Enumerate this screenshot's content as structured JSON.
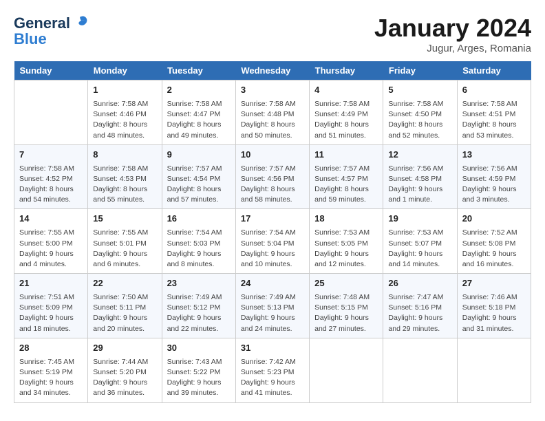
{
  "logo": {
    "line1": "General",
    "line2": "Blue"
  },
  "title": "January 2024",
  "location": "Jugur, Arges, Romania",
  "days_header": [
    "Sunday",
    "Monday",
    "Tuesday",
    "Wednesday",
    "Thursday",
    "Friday",
    "Saturday"
  ],
  "weeks": [
    [
      {
        "day": "",
        "sunrise": "",
        "sunset": "",
        "daylight": ""
      },
      {
        "day": "1",
        "sunrise": "7:58 AM",
        "sunset": "4:46 PM",
        "daylight": "8 hours and 48 minutes."
      },
      {
        "day": "2",
        "sunrise": "7:58 AM",
        "sunset": "4:47 PM",
        "daylight": "8 hours and 49 minutes."
      },
      {
        "day": "3",
        "sunrise": "7:58 AM",
        "sunset": "4:48 PM",
        "daylight": "8 hours and 50 minutes."
      },
      {
        "day": "4",
        "sunrise": "7:58 AM",
        "sunset": "4:49 PM",
        "daylight": "8 hours and 51 minutes."
      },
      {
        "day": "5",
        "sunrise": "7:58 AM",
        "sunset": "4:50 PM",
        "daylight": "8 hours and 52 minutes."
      },
      {
        "day": "6",
        "sunrise": "7:58 AM",
        "sunset": "4:51 PM",
        "daylight": "8 hours and 53 minutes."
      }
    ],
    [
      {
        "day": "7",
        "sunrise": "7:58 AM",
        "sunset": "4:52 PM",
        "daylight": "8 hours and 54 minutes."
      },
      {
        "day": "8",
        "sunrise": "7:58 AM",
        "sunset": "4:53 PM",
        "daylight": "8 hours and 55 minutes."
      },
      {
        "day": "9",
        "sunrise": "7:57 AM",
        "sunset": "4:54 PM",
        "daylight": "8 hours and 57 minutes."
      },
      {
        "day": "10",
        "sunrise": "7:57 AM",
        "sunset": "4:56 PM",
        "daylight": "8 hours and 58 minutes."
      },
      {
        "day": "11",
        "sunrise": "7:57 AM",
        "sunset": "4:57 PM",
        "daylight": "8 hours and 59 minutes."
      },
      {
        "day": "12",
        "sunrise": "7:56 AM",
        "sunset": "4:58 PM",
        "daylight": "9 hours and 1 minute."
      },
      {
        "day": "13",
        "sunrise": "7:56 AM",
        "sunset": "4:59 PM",
        "daylight": "9 hours and 3 minutes."
      }
    ],
    [
      {
        "day": "14",
        "sunrise": "7:55 AM",
        "sunset": "5:00 PM",
        "daylight": "9 hours and 4 minutes."
      },
      {
        "day": "15",
        "sunrise": "7:55 AM",
        "sunset": "5:01 PM",
        "daylight": "9 hours and 6 minutes."
      },
      {
        "day": "16",
        "sunrise": "7:54 AM",
        "sunset": "5:03 PM",
        "daylight": "9 hours and 8 minutes."
      },
      {
        "day": "17",
        "sunrise": "7:54 AM",
        "sunset": "5:04 PM",
        "daylight": "9 hours and 10 minutes."
      },
      {
        "day": "18",
        "sunrise": "7:53 AM",
        "sunset": "5:05 PM",
        "daylight": "9 hours and 12 minutes."
      },
      {
        "day": "19",
        "sunrise": "7:53 AM",
        "sunset": "5:07 PM",
        "daylight": "9 hours and 14 minutes."
      },
      {
        "day": "20",
        "sunrise": "7:52 AM",
        "sunset": "5:08 PM",
        "daylight": "9 hours and 16 minutes."
      }
    ],
    [
      {
        "day": "21",
        "sunrise": "7:51 AM",
        "sunset": "5:09 PM",
        "daylight": "9 hours and 18 minutes."
      },
      {
        "day": "22",
        "sunrise": "7:50 AM",
        "sunset": "5:11 PM",
        "daylight": "9 hours and 20 minutes."
      },
      {
        "day": "23",
        "sunrise": "7:49 AM",
        "sunset": "5:12 PM",
        "daylight": "9 hours and 22 minutes."
      },
      {
        "day": "24",
        "sunrise": "7:49 AM",
        "sunset": "5:13 PM",
        "daylight": "9 hours and 24 minutes."
      },
      {
        "day": "25",
        "sunrise": "7:48 AM",
        "sunset": "5:15 PM",
        "daylight": "9 hours and 27 minutes."
      },
      {
        "day": "26",
        "sunrise": "7:47 AM",
        "sunset": "5:16 PM",
        "daylight": "9 hours and 29 minutes."
      },
      {
        "day": "27",
        "sunrise": "7:46 AM",
        "sunset": "5:18 PM",
        "daylight": "9 hours and 31 minutes."
      }
    ],
    [
      {
        "day": "28",
        "sunrise": "7:45 AM",
        "sunset": "5:19 PM",
        "daylight": "9 hours and 34 minutes."
      },
      {
        "day": "29",
        "sunrise": "7:44 AM",
        "sunset": "5:20 PM",
        "daylight": "9 hours and 36 minutes."
      },
      {
        "day": "30",
        "sunrise": "7:43 AM",
        "sunset": "5:22 PM",
        "daylight": "9 hours and 39 minutes."
      },
      {
        "day": "31",
        "sunrise": "7:42 AM",
        "sunset": "5:23 PM",
        "daylight": "9 hours and 41 minutes."
      },
      {
        "day": "",
        "sunrise": "",
        "sunset": "",
        "daylight": ""
      },
      {
        "day": "",
        "sunrise": "",
        "sunset": "",
        "daylight": ""
      },
      {
        "day": "",
        "sunrise": "",
        "sunset": "",
        "daylight": ""
      }
    ]
  ]
}
